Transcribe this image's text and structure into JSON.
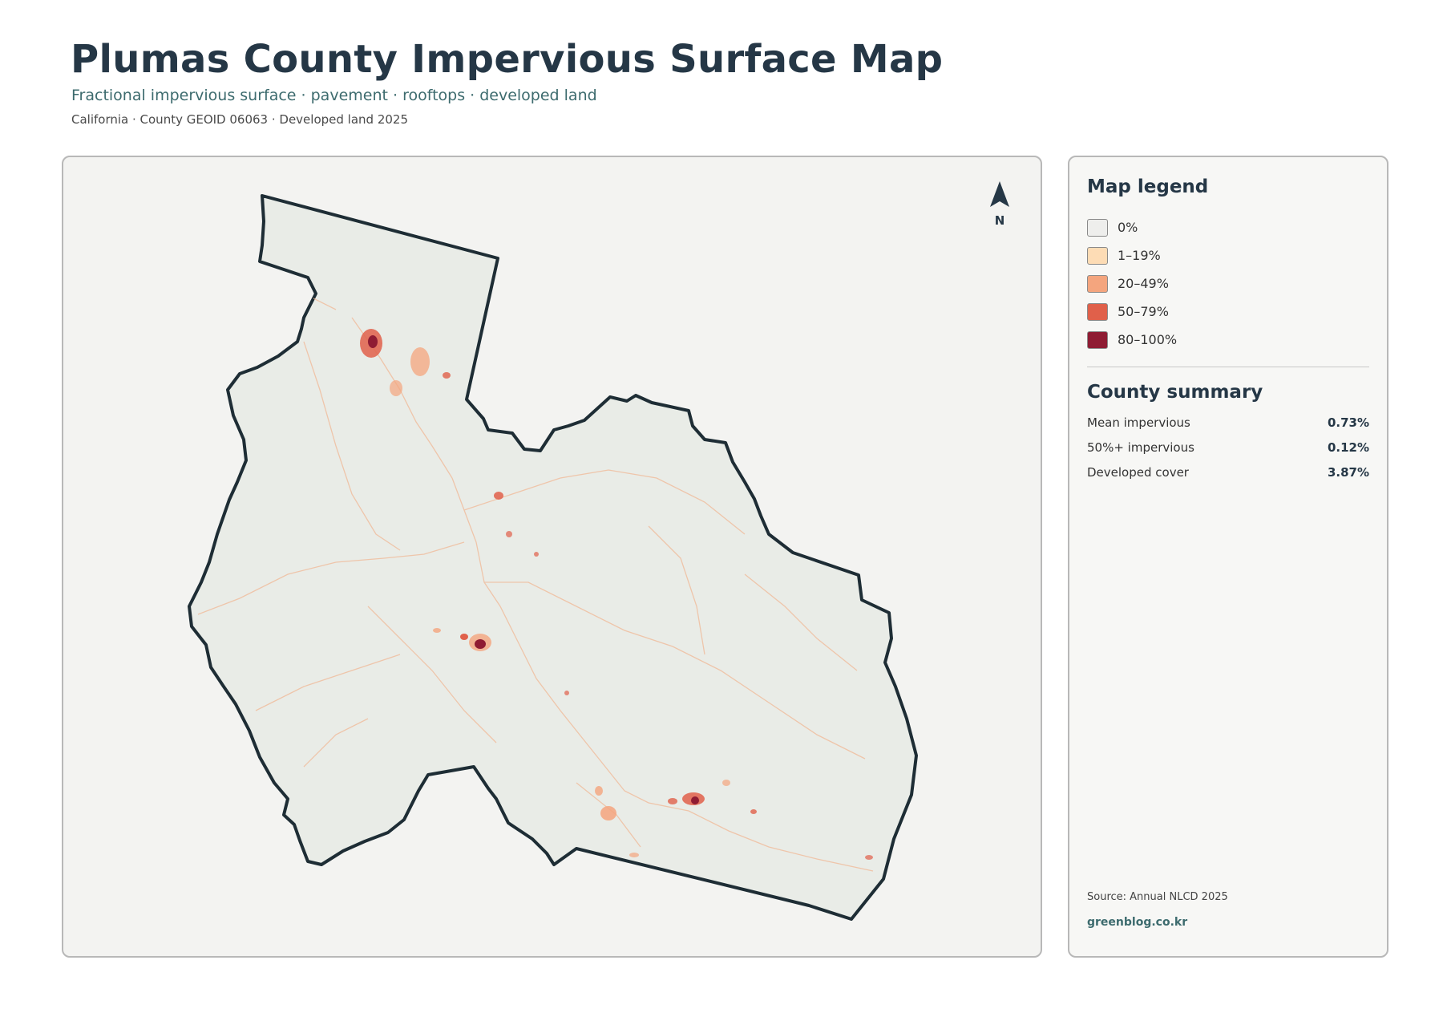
{
  "header": {
    "title": "Plumas County Impervious Surface Map",
    "subtitle": "Fractional impervious surface · pavement · rooftops · developed land",
    "meta": "California · County GEOID 06063 · Developed land 2025"
  },
  "map": {
    "north_label": "N",
    "county_fill": "#e9ece7",
    "boundary_color": "#1e2d35"
  },
  "legend": {
    "title": "Map legend",
    "items": [
      {
        "label": "0%",
        "color": "#eeeeec"
      },
      {
        "label": "1–19%",
        "color": "#fddcb5"
      },
      {
        "label": "20–49%",
        "color": "#f4a57e"
      },
      {
        "label": "50–79%",
        "color": "#e0604a"
      },
      {
        "label": "80–100%",
        "color": "#8f1c33"
      }
    ]
  },
  "summary": {
    "title": "County summary",
    "rows": [
      {
        "label": "Mean impervious",
        "value": "0.73%"
      },
      {
        "label": "50%+ impervious",
        "value": "0.12%"
      },
      {
        "label": "Developed cover",
        "value": "3.87%"
      }
    ]
  },
  "footer": {
    "source": "Source: Annual NLCD 2025",
    "credit": "greenblog.co.kr"
  }
}
